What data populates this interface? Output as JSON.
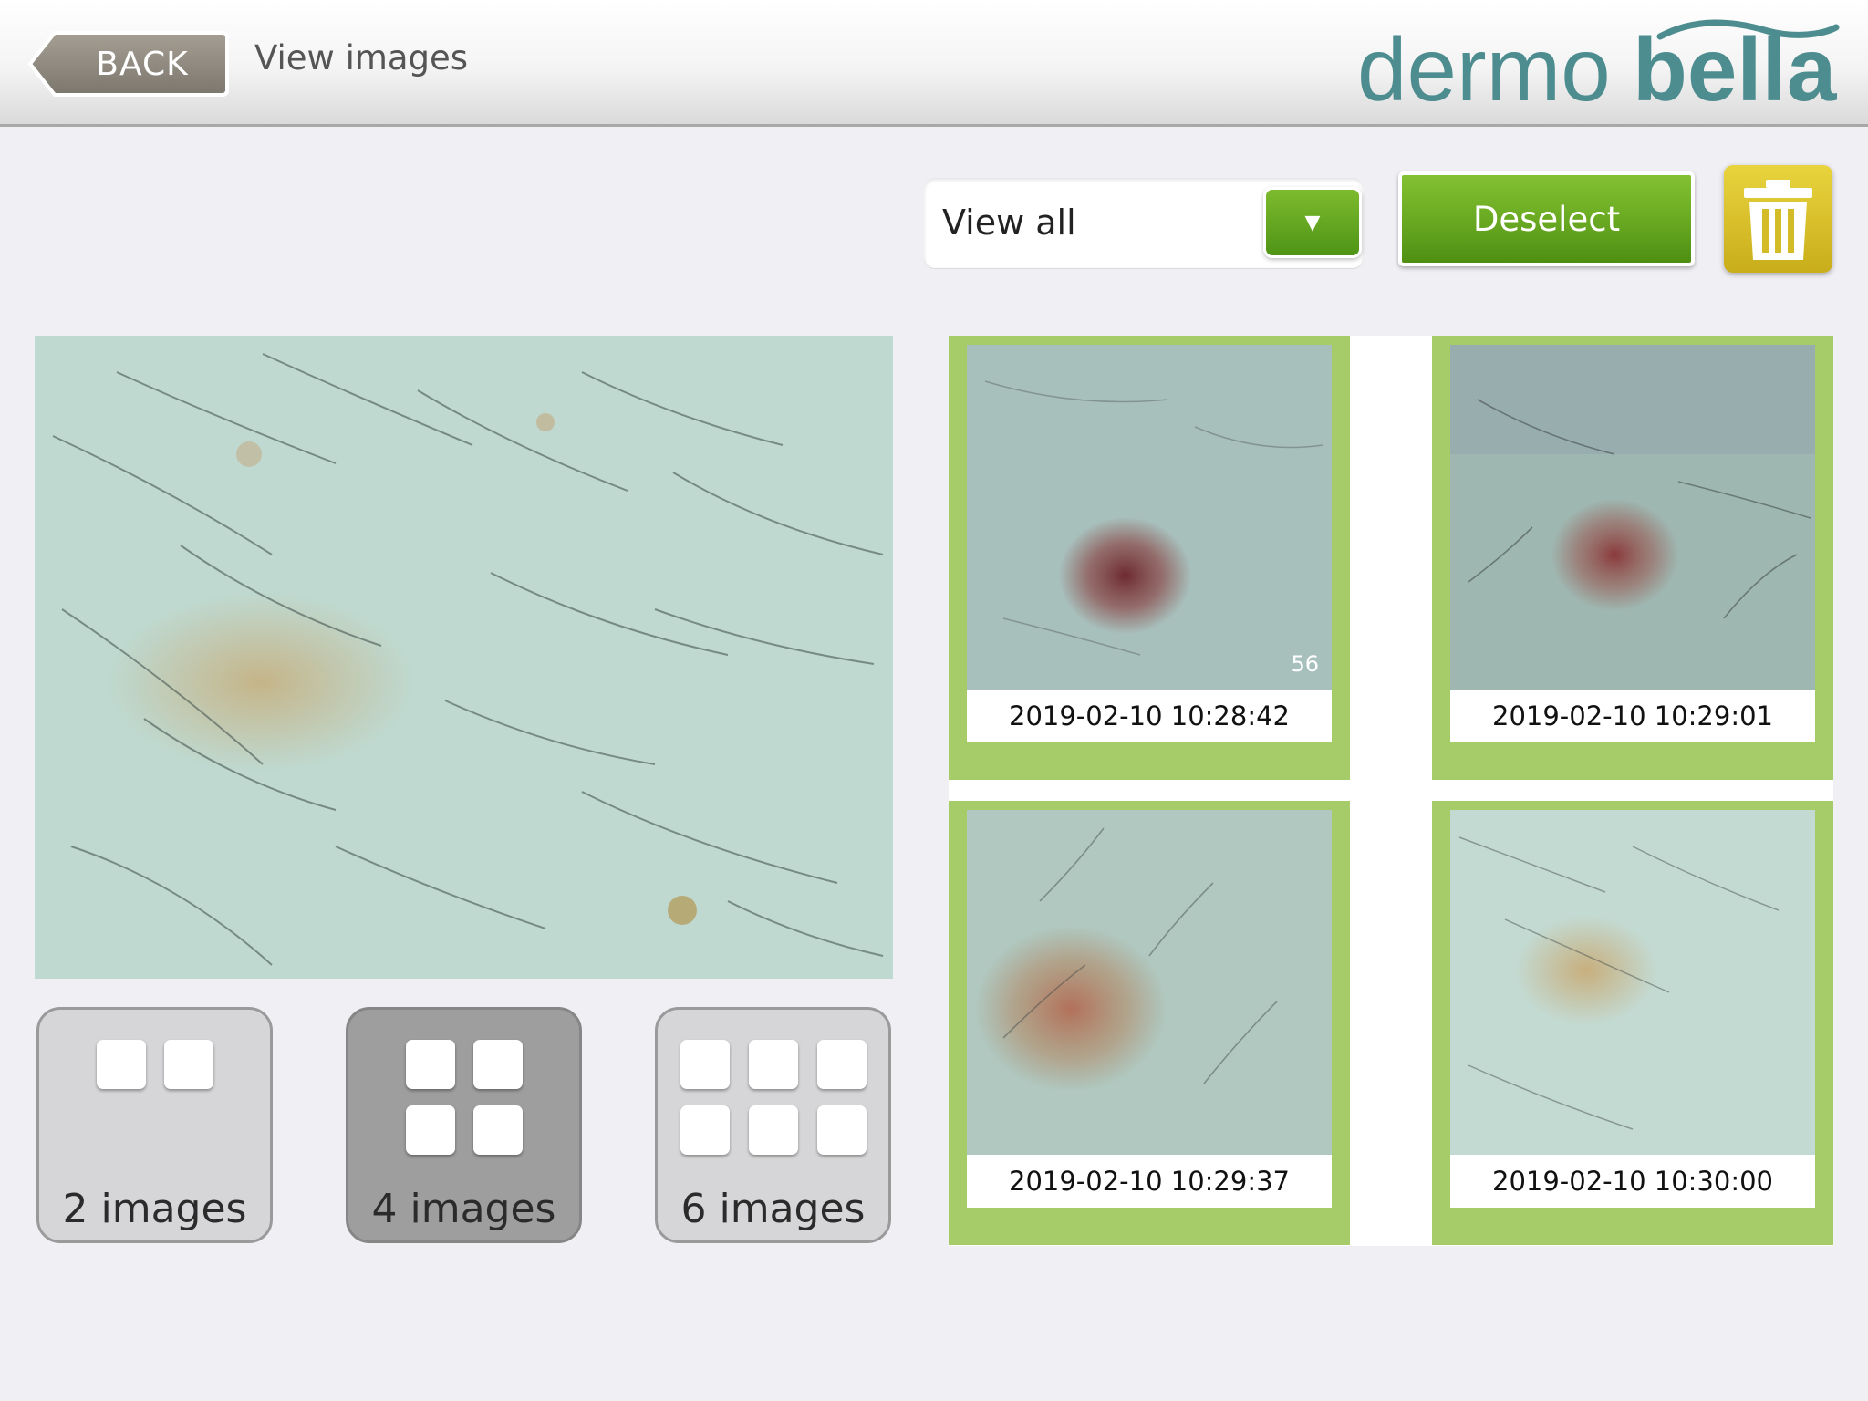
{
  "header": {
    "back_label": "BACK",
    "title": "View images"
  },
  "logo": {
    "part1": "dermo",
    "part2": "bella",
    "color": "#4d8c8f"
  },
  "toolbar": {
    "filter_value": "View all",
    "deselect_label": "Deselect"
  },
  "layout_options": [
    {
      "label": "2 images",
      "selected": false
    },
    {
      "label": "4 images",
      "selected": true
    },
    {
      "label": "6 images",
      "selected": false
    }
  ],
  "thumbnails": [
    {
      "timestamp": "2019-02-10 10:28:42",
      "badge": "56"
    },
    {
      "timestamp": "2019-02-10 10:29:01"
    },
    {
      "timestamp": "2019-02-10 10:29:37"
    },
    {
      "timestamp": "2019-02-10 10:30:00"
    }
  ],
  "colors": {
    "accent_green": "#6aaa22",
    "selection_frame": "#a6cc6a",
    "trash_yellow": "#d4bc28"
  }
}
